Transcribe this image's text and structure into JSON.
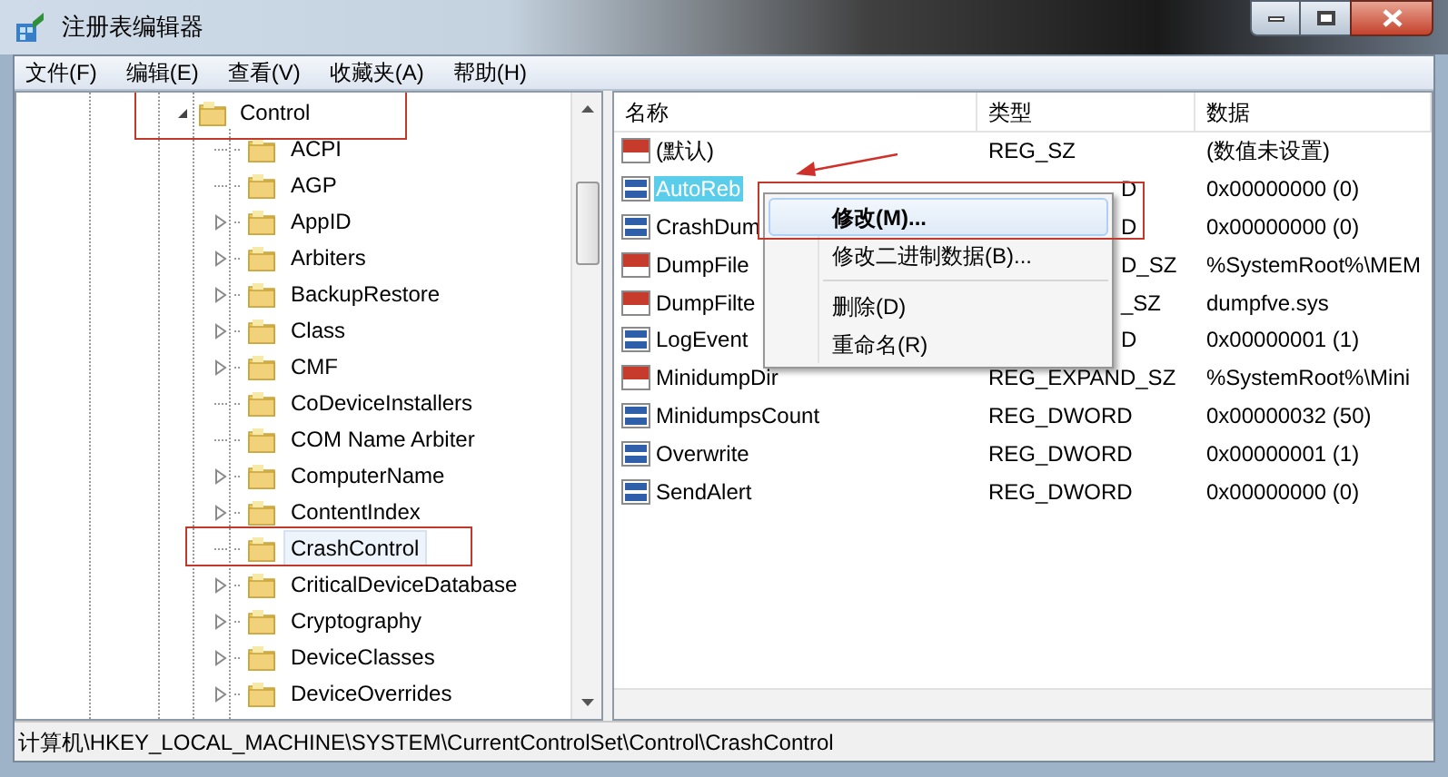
{
  "window": {
    "title": "注册表编辑器"
  },
  "menu": [
    "文件(F)",
    "编辑(E)",
    "查看(V)",
    "收藏夹(A)",
    "帮助(H)"
  ],
  "tree": {
    "label": "Control",
    "expanded": true,
    "selected": false,
    "children": [
      {
        "label": "ACPI",
        "expandable": false,
        "selected": false
      },
      {
        "label": "AGP",
        "expandable": false,
        "selected": false
      },
      {
        "label": "AppID",
        "expandable": true,
        "selected": false
      },
      {
        "label": "Arbiters",
        "expandable": true,
        "selected": false
      },
      {
        "label": "BackupRestore",
        "expandable": true,
        "selected": false
      },
      {
        "label": "Class",
        "expandable": true,
        "selected": false
      },
      {
        "label": "CMF",
        "expandable": true,
        "selected": false
      },
      {
        "label": "CoDeviceInstallers",
        "expandable": false,
        "selected": false
      },
      {
        "label": "COM Name Arbiter",
        "expandable": false,
        "selected": false
      },
      {
        "label": "ComputerName",
        "expandable": true,
        "selected": false
      },
      {
        "label": "ContentIndex",
        "expandable": true,
        "selected": false
      },
      {
        "label": "CrashControl",
        "expandable": false,
        "selected": true
      },
      {
        "label": "CriticalDeviceDatabase",
        "expandable": true,
        "selected": false
      },
      {
        "label": "Cryptography",
        "expandable": true,
        "selected": false
      },
      {
        "label": "DeviceClasses",
        "expandable": true,
        "selected": false
      },
      {
        "label": "DeviceOverrides",
        "expandable": true,
        "selected": false
      }
    ]
  },
  "table": {
    "columns": [
      "名称",
      "类型",
      "数据"
    ],
    "rows": [
      {
        "kind": "string",
        "name": "(默认)",
        "type": "REG_SZ",
        "covered": false,
        "data": "(数值未设置)",
        "selected": false
      },
      {
        "kind": "dword",
        "name": "AutoReb",
        "type": "D",
        "covered": true,
        "data": "0x00000000 (0)",
        "selected": true
      },
      {
        "kind": "dword",
        "name": "CrashDum",
        "type": "D",
        "covered": true,
        "data": "0x00000000 (0)",
        "selected": false
      },
      {
        "kind": "string",
        "name": "DumpFile",
        "type": "D_SZ",
        "covered": true,
        "data": "%SystemRoot%\\MEM",
        "selected": false
      },
      {
        "kind": "string",
        "name": "DumpFilte",
        "type": "_SZ",
        "covered": true,
        "data": "dumpfve.sys",
        "selected": false
      },
      {
        "kind": "dword",
        "name": "LogEvent",
        "type": "D",
        "covered": true,
        "data": "0x00000001 (1)",
        "selected": false
      },
      {
        "kind": "string",
        "name": "MinidumpDir",
        "type": "REG_EXPAND_SZ",
        "covered": false,
        "data": "%SystemRoot%\\Mini",
        "selected": false
      },
      {
        "kind": "dword",
        "name": "MinidumpsCount",
        "type": "REG_DWORD",
        "covered": false,
        "data": "0x00000032 (50)",
        "selected": false
      },
      {
        "kind": "dword",
        "name": "Overwrite",
        "type": "REG_DWORD",
        "covered": false,
        "data": "0x00000001 (1)",
        "selected": false
      },
      {
        "kind": "dword",
        "name": "SendAlert",
        "type": "REG_DWORD",
        "covered": false,
        "data": "0x00000000 (0)",
        "selected": false
      }
    ]
  },
  "context_menu": [
    {
      "kind": "item",
      "label": "修改(M)...",
      "bold": true,
      "selected": true
    },
    {
      "kind": "item",
      "label": "修改二进制数据(B)...",
      "bold": false,
      "selected": false
    },
    {
      "kind": "separator"
    },
    {
      "kind": "item",
      "label": "删除(D)",
      "bold": false,
      "selected": false
    },
    {
      "kind": "item",
      "label": "重命名(R)",
      "bold": false,
      "selected": false
    }
  ],
  "status_bar": "计算机\\HKEY_LOCAL_MACHINE\\SYSTEM\\CurrentControlSet\\Control\\CrashControl"
}
